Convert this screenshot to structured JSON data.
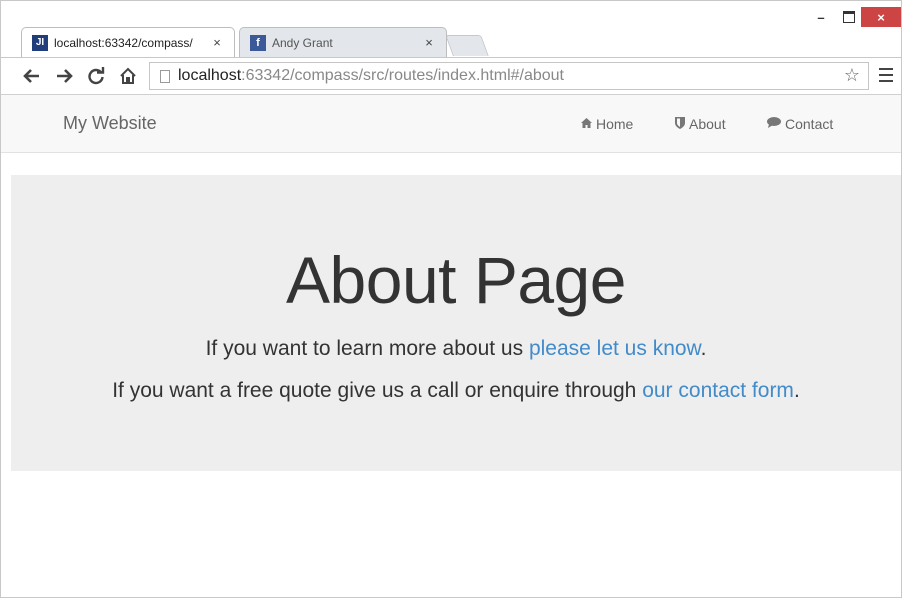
{
  "browser": {
    "tabs": [
      {
        "title": "localhost:63342/compass/",
        "favicon": "jetbrains-icon",
        "active": true
      },
      {
        "title": "Andy Grant",
        "favicon": "facebook-icon",
        "active": false
      }
    ],
    "tab_close_glyph": "×",
    "address": {
      "host": "localhost",
      "rest": ":63342/compass/src/routes/index.html#/about"
    },
    "window_controls": {
      "minimize": "–",
      "close": "×"
    }
  },
  "site": {
    "brand": "My Website",
    "nav": [
      {
        "label": "Home",
        "icon": "home-icon"
      },
      {
        "label": "About",
        "icon": "shield-icon"
      },
      {
        "label": "Contact",
        "icon": "comment-icon"
      }
    ]
  },
  "page": {
    "heading": "About Page",
    "line1": {
      "text": "If you want to learn more about us ",
      "link": "please let us know",
      "end": "."
    },
    "line2": {
      "text": "If you want a free quote give us a call or enquire through ",
      "link": "our contact form",
      "end": "."
    }
  },
  "colors": {
    "link": "#428bca",
    "close_button": "#cc4444",
    "jumbotron_bg": "#eeeeee"
  }
}
